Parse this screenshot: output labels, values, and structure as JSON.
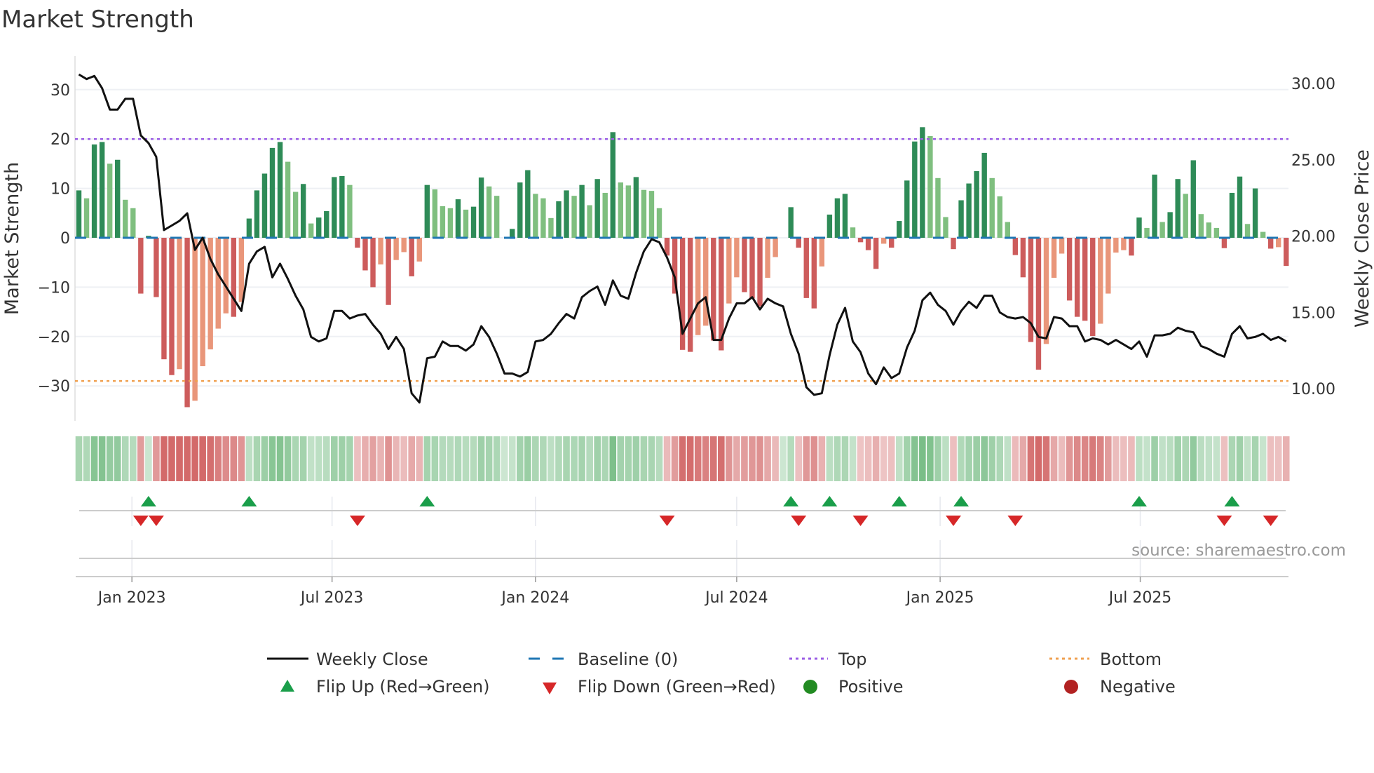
{
  "title": "Market Strength",
  "source": "source: sharemaestro.com",
  "chart_data": {
    "type": "bar",
    "title": "Market Strength",
    "ylabel": "Market Strength",
    "y2label": "Weekly Close Price",
    "ylim": [
      -35,
      36
    ],
    "y2lim": [
      8.7,
      31.0
    ],
    "yticks": [
      {
        "v": 30,
        "label": "30"
      },
      {
        "v": 20,
        "label": "20"
      },
      {
        "v": 10,
        "label": "10"
      },
      {
        "v": 0,
        "label": "0"
      },
      {
        "v": -10,
        "label": "−10"
      },
      {
        "v": -20,
        "label": "−20"
      },
      {
        "v": -30,
        "label": "−30"
      }
    ],
    "y2ticks": [
      {
        "v": 30,
        "label": "30.00"
      },
      {
        "v": 25,
        "label": "25.00"
      },
      {
        "v": 20,
        "label": "20.00"
      },
      {
        "v": 15,
        "label": "15.00"
      },
      {
        "v": 10,
        "label": "10.00"
      }
    ],
    "x_start": "2022-11-14",
    "x_step_days": 7,
    "xticks": [
      {
        "date": "2023-01-01",
        "label": "Jan 2023"
      },
      {
        "date": "2023-07-01",
        "label": "Jul 2023"
      },
      {
        "date": "2024-01-01",
        "label": "Jan 2024"
      },
      {
        "date": "2024-07-01",
        "label": "Jul 2024"
      },
      {
        "date": "2025-01-01",
        "label": "Jan 2025"
      },
      {
        "date": "2025-07-01",
        "label": "Jul 2025"
      }
    ],
    "top_level": 20,
    "bottom_level": -29,
    "baseline": 0,
    "strength": [
      9.6,
      8.0,
      18.9,
      19.4,
      15.0,
      15.8,
      7.7,
      6.0,
      -11.3,
      0.4,
      -12.0,
      -24.6,
      -27.8,
      -26.6,
      -34.3,
      -33.0,
      -26.0,
      -22.6,
      -18.4,
      -15.3,
      -16.0,
      -13.0,
      3.9,
      9.6,
      13.0,
      18.2,
      19.4,
      15.4,
      9.3,
      10.9,
      2.9,
      4.1,
      5.4,
      12.3,
      12.5,
      10.7,
      -2.0,
      -6.6,
      -10.0,
      -5.4,
      -13.6,
      -4.5,
      -2.9,
      -7.8,
      -4.8,
      10.7,
      9.8,
      6.4,
      6.0,
      7.8,
      5.7,
      6.3,
      12.2,
      10.4,
      8.5,
      0,
      1.8,
      11.2,
      13.7,
      8.9,
      8.0,
      4.0,
      7.4,
      9.6,
      8.5,
      10.7,
      6.6,
      11.9,
      9.1,
      21.4,
      11.2,
      10.6,
      12.3,
      9.7,
      9.5,
      6.0,
      -3.6,
      -11.3,
      -22.7,
      -23.1,
      -19.7,
      -17.8,
      -20.8,
      -22.8,
      -13.3,
      -8.0,
      -11.0,
      -12.3,
      -13.9,
      -8.1,
      -3.9,
      0,
      6.2,
      -2.0,
      -12.2,
      -14.3,
      -5.8,
      4.7,
      8.0,
      8.9,
      2.1,
      -0.9,
      -2.5,
      -6.3,
      -1.2,
      -2.0,
      3.4,
      11.6,
      19.5,
      22.4,
      20.6,
      12.1,
      4.2,
      -2.3,
      7.6,
      11.0,
      13.5,
      17.2,
      12.1,
      8.4,
      3.2,
      -3.5,
      -8.0,
      -21.1,
      -26.7,
      -21.5,
      -8.1,
      -3.2,
      -12.7,
      -16.0,
      -16.8,
      -19.9,
      -17.4,
      -11.3,
      -3.0,
      -2.5,
      -3.6,
      4.1,
      2.0,
      12.8,
      3.2,
      5.2,
      11.9,
      8.9,
      15.7,
      4.8,
      3.1,
      2.0,
      -2.1,
      9.1,
      12.4,
      2.8,
      10.0,
      1.2,
      -2.2,
      -1.9,
      -5.7
    ],
    "strong": [
      1,
      0,
      1,
      1,
      0,
      1,
      0,
      0,
      1,
      1,
      1,
      1,
      1,
      0,
      1,
      0,
      0,
      0,
      0,
      0,
      1,
      0,
      1,
      1,
      1,
      1,
      1,
      0,
      0,
      1,
      0,
      1,
      1,
      1,
      1,
      0,
      1,
      1,
      1,
      0,
      1,
      0,
      0,
      1,
      0,
      1,
      0,
      0,
      0,
      1,
      0,
      1,
      1,
      0,
      0,
      0,
      1,
      1,
      1,
      0,
      0,
      0,
      1,
      1,
      0,
      1,
      0,
      1,
      0,
      1,
      0,
      0,
      1,
      0,
      0,
      0,
      1,
      1,
      1,
      1,
      0,
      0,
      1,
      1,
      0,
      0,
      1,
      1,
      1,
      0,
      0,
      0,
      1,
      1,
      1,
      1,
      0,
      1,
      1,
      1,
      0,
      1,
      1,
      1,
      0,
      1,
      1,
      1,
      1,
      1,
      0,
      0,
      0,
      1,
      1,
      1,
      1,
      1,
      0,
      0,
      0,
      1,
      1,
      1,
      1,
      0,
      0,
      0,
      1,
      1,
      1,
      1,
      0,
      0,
      0,
      0,
      1,
      1,
      0,
      1,
      0,
      1,
      1,
      0,
      1,
      0,
      0,
      0,
      1,
      1,
      1,
      0,
      1,
      0,
      1,
      0,
      1
    ],
    "weekly_close": [
      30.6,
      30.3,
      30.5,
      29.7,
      28.3,
      28.3,
      29.0,
      29.0,
      26.6,
      26.1,
      25.2,
      20.4,
      20.7,
      21.0,
      21.5,
      19.1,
      19.9,
      18.5,
      17.5,
      16.7,
      15.9,
      15.1,
      18.2,
      19.0,
      19.3,
      17.3,
      18.2,
      17.2,
      16.1,
      15.2,
      13.4,
      13.1,
      13.3,
      15.1,
      15.1,
      14.6,
      14.8,
      14.9,
      14.2,
      13.6,
      12.6,
      13.4,
      12.6,
      9.7,
      9.1,
      12.0,
      12.1,
      13.1,
      12.8,
      12.8,
      12.5,
      12.9,
      14.1,
      13.4,
      12.3,
      11.0,
      11.0,
      10.8,
      11.1,
      13.1,
      13.2,
      13.6,
      14.3,
      14.9,
      14.6,
      16.0,
      16.4,
      16.7,
      15.5,
      17.1,
      16.1,
      15.9,
      17.6,
      19.0,
      19.8,
      19.6,
      18.6,
      17.3,
      13.6,
      14.6,
      15.6,
      16.0,
      13.2,
      13.2,
      14.6,
      15.6,
      15.6,
      16.0,
      15.2,
      15.9,
      15.6,
      15.4,
      13.6,
      12.3,
      10.1,
      9.6,
      9.7,
      12.2,
      14.2,
      15.3,
      13.1,
      12.4,
      11.0,
      10.3,
      11.4,
      10.7,
      11.0,
      12.7,
      13.8,
      15.8,
      16.3,
      15.5,
      15.1,
      14.2,
      15.1,
      15.7,
      15.3,
      16.1,
      16.1,
      15.0,
      14.7,
      14.6,
      14.7,
      14.3,
      13.4,
      13.3,
      14.7,
      14.6,
      14.1,
      14.1,
      13.1,
      13.3,
      13.2,
      12.9,
      13.2,
      12.9,
      12.6,
      13.1,
      12.1,
      13.5,
      13.5,
      13.6,
      14.0,
      13.8,
      13.7,
      12.8,
      12.6,
      12.3,
      12.1,
      13.6,
      14.1,
      13.3,
      13.4,
      13.6,
      13.2,
      13.4,
      13.1
    ],
    "flip_up_index": [
      9,
      22,
      45,
      92,
      97,
      106,
      114,
      137,
      149
    ],
    "flip_down_index": [
      8,
      10,
      36,
      76,
      93,
      101,
      113,
      121,
      148,
      154
    ],
    "legend": {
      "placement": "bottom",
      "items": [
        "Weekly Close",
        "Baseline (0)",
        "Top",
        "Bottom",
        "Flip Up (Red→Green)",
        "Flip Down (Green→Red)",
        "Positive",
        "Negative"
      ]
    },
    "colors": {
      "pos_strong": "#2e8b57",
      "pos_weak": "#7fbf7f",
      "neg_strong": "#cd5c5c",
      "neg_weak": "#e9967a",
      "close": "#111111",
      "baseline": "#1f77b4",
      "top": "#9b5de5",
      "bottom": "#f0a050",
      "flip_up": "#1a9e4a",
      "flip_down": "#d62728",
      "positive": "#228b22",
      "negative": "#b22222"
    }
  }
}
